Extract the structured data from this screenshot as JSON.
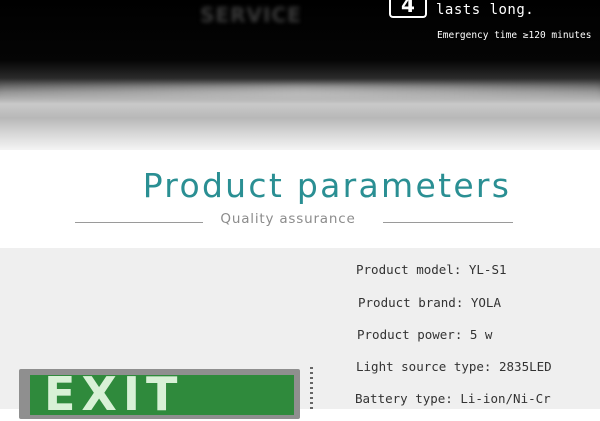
{
  "banner": {
    "blurred_text": "SERVICE",
    "number_badge": "4",
    "headline": "lasts long.",
    "emergency_time": "Emergency time ≥120 minutes"
  },
  "section": {
    "title": "Product parameters",
    "subtitle": "Quality assurance"
  },
  "params": [
    "Product model: YL-S1",
    "Product brand: YOLA",
    "Product power: 5 w",
    "Light source type: 2835LED",
    "Battery type: Li-ion/Ni-Cr"
  ],
  "sign": {
    "text": "EXIT"
  },
  "colors": {
    "title_teal": "#2a8f93",
    "sign_green": "#2f8a3c"
  }
}
